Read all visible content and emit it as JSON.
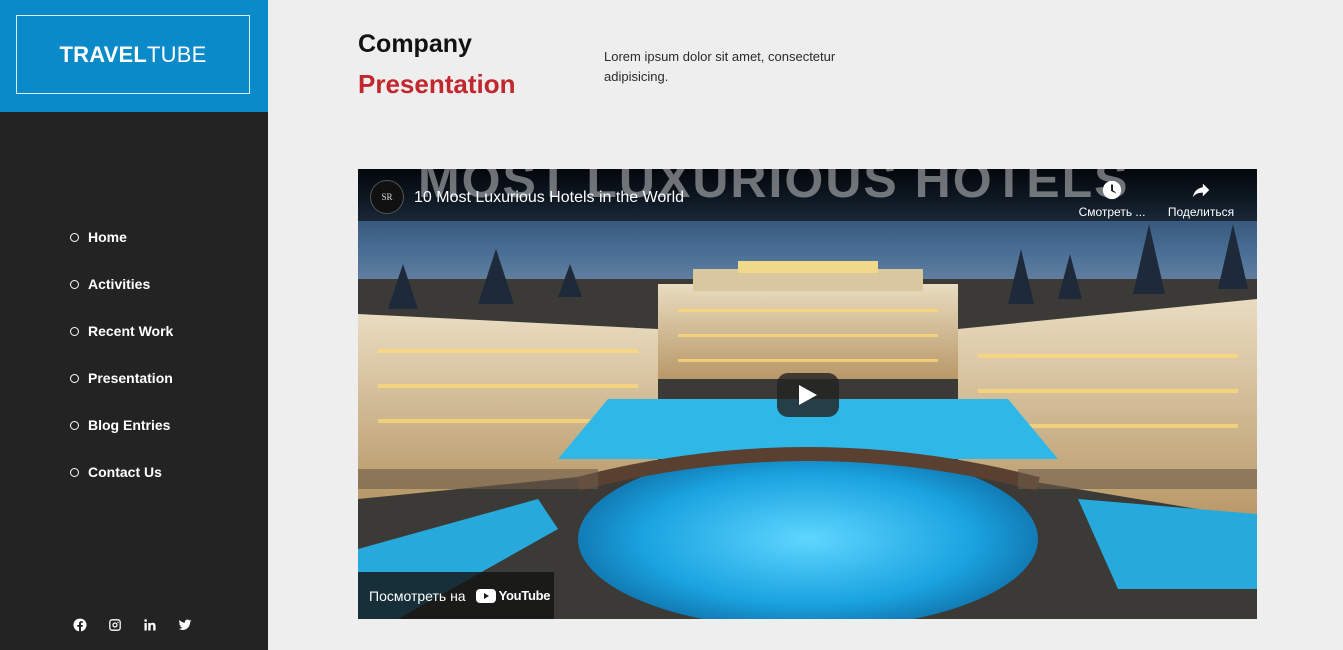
{
  "brand": {
    "name_bold": "TRAVEL",
    "name_light": "TUBE",
    "color": "#0a8ac9"
  },
  "nav": {
    "items": [
      {
        "label": "Home"
      },
      {
        "label": "Activities"
      },
      {
        "label": "Recent Work"
      },
      {
        "label": "Presentation"
      },
      {
        "label": "Blog Entries"
      },
      {
        "label": "Contact Us"
      }
    ]
  },
  "socials": [
    "facebook-icon",
    "instagram-icon",
    "linkedin-icon",
    "twitter-icon"
  ],
  "section": {
    "title_line1": "Company",
    "title_line2": "Presentation",
    "accent_color": "#c1272d",
    "description": "Lorem ipsum dolor sit amet, consectetur adipisicing."
  },
  "video": {
    "overlay_heading": "MOST LUXURIOUS HOTELS",
    "channel_initials": "SR",
    "title": "10 Most Luxurious Hotels in the World",
    "watch_later_label": "Смотреть ...",
    "share_label": "Поделиться",
    "watch_on_label": "Посмотреть на",
    "platform": "YouTube"
  }
}
